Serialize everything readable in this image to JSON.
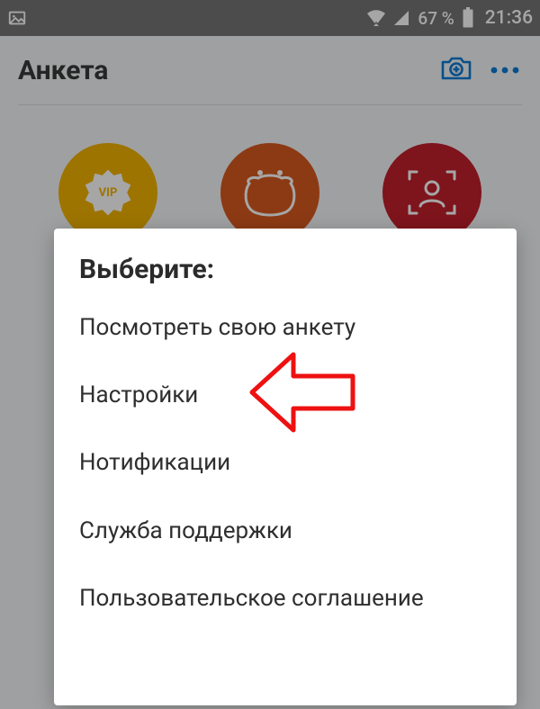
{
  "statusbar": {
    "battery_pct": "67 %",
    "clock": "21:36"
  },
  "header": {
    "title": "Анкета"
  },
  "modal": {
    "title": "Выберите:",
    "items": [
      "Посмотреть свою анкету",
      "Настройки",
      "Нотификации",
      "Служба поддержки",
      "Пользовательское соглашение"
    ]
  }
}
